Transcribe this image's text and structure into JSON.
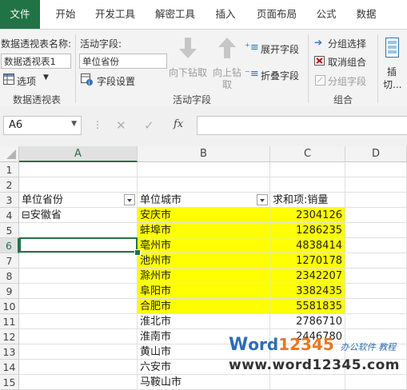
{
  "tabs": [
    "文件",
    "开始",
    "开发工具",
    "解密工具",
    "插入",
    "页面布局",
    "公式",
    "数据"
  ],
  "ribbon": {
    "pivot_name_label": "数据透视表名称:",
    "pivot_name_value": "数据透视表1",
    "options_label": "选项",
    "active_field_label": "活动字段:",
    "active_field_value": "单位省份",
    "field_settings_label": "字段设置",
    "drill_down_label": "向下钻取",
    "drill_up_label": "向上钻\n取",
    "drill_up_line1": "向上钻",
    "drill_up_line2": "取",
    "expand_field_label": "展开字段",
    "collapse_field_label": "折叠字段",
    "group_selection_label": "分组选择",
    "ungroup_label": "取消组合",
    "group_field_label": "分组字段",
    "insert_line1": "插",
    "insert_line2": "切...",
    "group_pivot_label": "数据透视表",
    "group_active_label": "活动字段",
    "group_group_label": "组合"
  },
  "formula_bar": {
    "name_box": "A6",
    "fx_label": "fx"
  },
  "columns": [
    "A",
    "B",
    "C",
    "D"
  ],
  "rows": [
    {
      "num": "1",
      "a": "",
      "b": "",
      "c": "",
      "yellow": false
    },
    {
      "num": "2",
      "a": "",
      "b": "",
      "c": "",
      "yellow": false
    },
    {
      "num": "3",
      "a": "单位省份",
      "b": "单位城市",
      "c": "求和项:销量",
      "yellow": false,
      "header": true
    },
    {
      "num": "4",
      "a": "⊟安徽省",
      "b": "安庆市",
      "c": "2304126",
      "yellow": true
    },
    {
      "num": "5",
      "a": "",
      "b": "蚌埠市",
      "c": "1286235",
      "yellow": true
    },
    {
      "num": "6",
      "a": "",
      "b": "亳州市",
      "c": "4838414",
      "yellow": true
    },
    {
      "num": "7",
      "a": "",
      "b": "池州市",
      "c": "1270178",
      "yellow": true
    },
    {
      "num": "8",
      "a": "",
      "b": "滁州市",
      "c": "2342207",
      "yellow": true
    },
    {
      "num": "9",
      "a": "",
      "b": "阜阳市",
      "c": "3382435",
      "yellow": true
    },
    {
      "num": "10",
      "a": "",
      "b": "合肥市",
      "c": "5581835",
      "yellow": true
    },
    {
      "num": "11",
      "a": "",
      "b": "淮北市",
      "c": "2786710",
      "yellow": false
    },
    {
      "num": "12",
      "a": "",
      "b": "淮南市",
      "c": "2446780",
      "yellow": false
    },
    {
      "num": "13",
      "a": "",
      "b": "黄山市",
      "c": "",
      "yellow": false
    },
    {
      "num": "14",
      "a": "",
      "b": "六安市",
      "c": "",
      "yellow": false
    },
    {
      "num": "15",
      "a": "",
      "b": "马鞍山市",
      "c": "",
      "yellow": false
    }
  ],
  "watermark": {
    "brand_w": "W",
    "brand_ord": "ord",
    "brand_num": "12345",
    "brand_tag": "办公软件 教程",
    "url": "www.word12345.com"
  }
}
